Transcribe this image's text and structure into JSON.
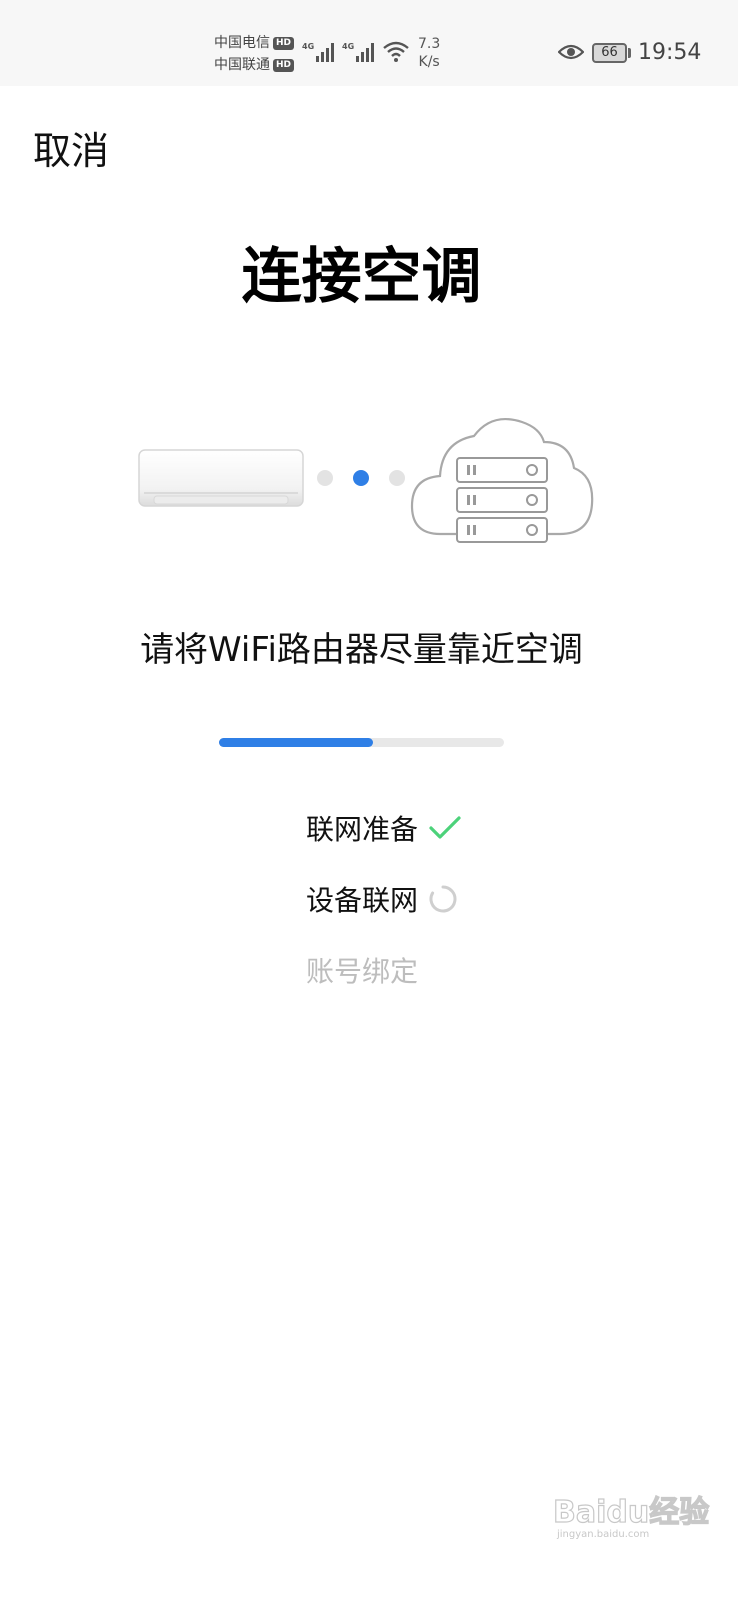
{
  "status_bar": {
    "carrier_1": "中国电信",
    "carrier_2": "中国联通",
    "hd_badge": "HD",
    "network_type": "4G",
    "net_speed_value": "7.3",
    "net_speed_unit": "K/s",
    "battery": "66",
    "time": "19:54"
  },
  "header": {
    "cancel_label": "取消",
    "title": "连接空调"
  },
  "illustration": {
    "active_dot_index": 1
  },
  "hint_text": "请将WiFi路由器尽量靠近空调",
  "progress": {
    "fraction": 0.54,
    "accent_color": "#2f7fe6"
  },
  "steps": [
    {
      "label": "联网准备",
      "state": "done"
    },
    {
      "label": "设备联网",
      "state": "in_progress"
    },
    {
      "label": "账号绑定",
      "state": "pending"
    }
  ],
  "watermark": {
    "text": "Baidu经验",
    "sub": "jingyan.baidu.com"
  },
  "colors": {
    "check": "#4cd27a",
    "spinner": "#cfcfcf",
    "pending_text": "#bdbdbd"
  }
}
